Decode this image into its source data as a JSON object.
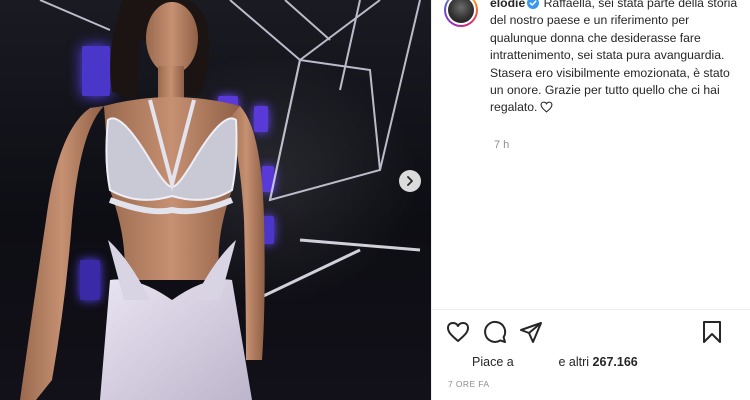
{
  "post": {
    "username": "elodie",
    "caption": "Raffaella, sei stata parte della storia del nostro paese e un riferimento per qualunque donna che desiderasse fare intrattenimento, sei stata pura avanguardia. Stasera ero visibilmente emozionata, è stato un onore. Grazie per tutto quello che ci hai regalato.",
    "relative_time": "7 h",
    "likes_prefix": "Piace a",
    "likes_suffix": "e altri",
    "likes_count": "267.166",
    "timestamp": "7 ORE FA"
  },
  "icons": {
    "verified": "verified-badge-icon",
    "caption_heart": "heart-outline-icon",
    "like": "heart-icon",
    "comment": "comment-icon",
    "share": "paper-plane-icon",
    "save": "bookmark-icon",
    "next": "chevron-right-icon"
  },
  "colors": {
    "verified": "#3897f0",
    "text": "#262626",
    "muted": "#8e8e8e",
    "stage_purple": "#5a46ff"
  }
}
